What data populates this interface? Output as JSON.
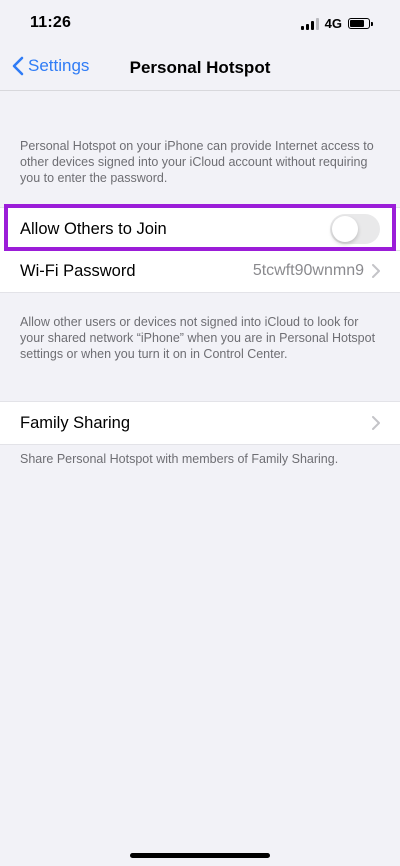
{
  "status_bar": {
    "time": "11:26",
    "network": "4G"
  },
  "nav": {
    "back_label": "Settings",
    "title": "Personal Hotspot"
  },
  "hotspot_intro": "Personal Hotspot on your iPhone can provide Internet access to other devices signed into your iCloud account without requiring you to enter the password.",
  "main_group": {
    "allow_others_label": "Allow Others to Join",
    "allow_others_on": false,
    "wifi_label": "Wi-Fi Password",
    "wifi_value": "5tcwft90wnmn9"
  },
  "allow_note": "Allow other users or devices not signed into iCloud to look for your shared network “iPhone” when you are in Personal Hotspot settings or when you turn it on in Control Center.",
  "family_group": {
    "label": "Family Sharing"
  },
  "family_note": "Share Personal Hotspot with members of Family Sharing.",
  "colors": {
    "accent": "#2f7cf6",
    "highlight": "#9b1dd8",
    "background": "#f2f2f7"
  }
}
